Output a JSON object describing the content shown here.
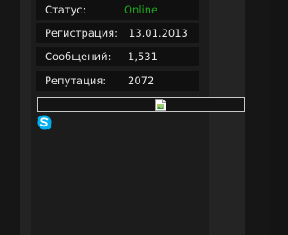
{
  "profile": {
    "rows": [
      {
        "label": "Статус:",
        "value": "Online"
      },
      {
        "label": "Регистрация:",
        "value": "13.01.2013"
      },
      {
        "label": "Сообщений:",
        "value": "1,531"
      },
      {
        "label": "Репутация:",
        "value": "2072"
      }
    ],
    "status_color": "#1fa81f"
  },
  "banner": {
    "image_icon": "broken-image-icon"
  },
  "contacts": {
    "skype_icon": "skype-icon",
    "skype_color": "#00aff0"
  }
}
